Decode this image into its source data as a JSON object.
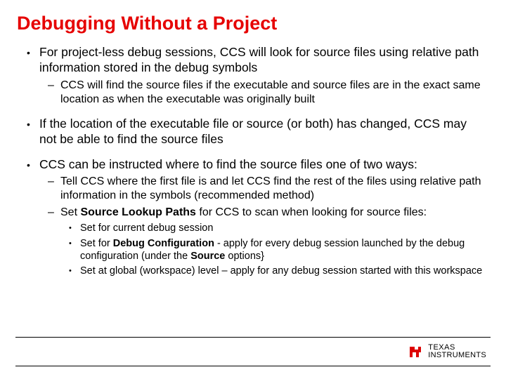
{
  "title": "Debugging Without a Project",
  "bullets": {
    "b1": "For project-less debug sessions, CCS will look for source files using relative path information stored in the debug symbols",
    "b1_1": "CCS will find the source files if the executable and source files are in the exact same location as when the executable was originally built",
    "b2": "If the location of the executable file or source (or both) has changed, CCS may not be able to find the source files",
    "b3": "CCS can be instructed where to find the source files one of two ways:",
    "b3_1": "Tell CCS where the first file is and let CCS find the rest of the files using relative path information in the symbols (recommended method)",
    "b3_2_pre": "Set ",
    "b3_2_bold": "Source Lookup Paths",
    "b3_2_post": " for CCS to scan when looking for source files:",
    "b3_2_1": "Set for current debug session",
    "b3_2_2_pre": "Set for ",
    "b3_2_2_bold1": "Debug Configuration",
    "b3_2_2_mid": " - apply for every debug session launched by the debug configuration (under the ",
    "b3_2_2_bold2": "Source",
    "b3_2_2_post": " options}",
    "b3_2_3": "Set at global (workspace) level – apply for any debug session started with this workspace"
  },
  "footer": {
    "brand_line1": "TEXAS",
    "brand_line2": "INSTRUMENTS"
  }
}
